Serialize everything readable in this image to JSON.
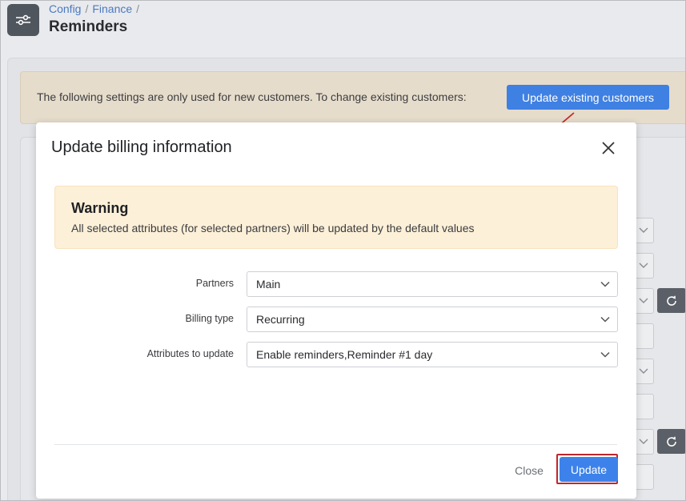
{
  "header": {
    "breadcrumb": [
      "Config",
      "Finance"
    ],
    "breadcrumb_separator": "/",
    "title": "Reminders",
    "icon": "sliders-icon"
  },
  "banner": {
    "text": "The following settings are only used for new customers. To change existing customers:",
    "button_label": "Update existing customers"
  },
  "modal": {
    "title": "Update billing information",
    "close_icon": "close-icon",
    "warning": {
      "title": "Warning",
      "text": "All selected attributes (for selected partners) will be updated by the default values"
    },
    "fields": [
      {
        "label": "Partners",
        "value": "Main"
      },
      {
        "label": "Billing type",
        "value": "Recurring"
      },
      {
        "label": "Attributes to update",
        "value": "Enable reminders,Reminder #1 day"
      }
    ],
    "close_label": "Close",
    "update_label": "Update"
  },
  "colors": {
    "primary_button": "#3f80e3",
    "warning_bg": "#fdf0d8",
    "highlight": "#c0262d",
    "banner_bg": "#e6dccb"
  }
}
